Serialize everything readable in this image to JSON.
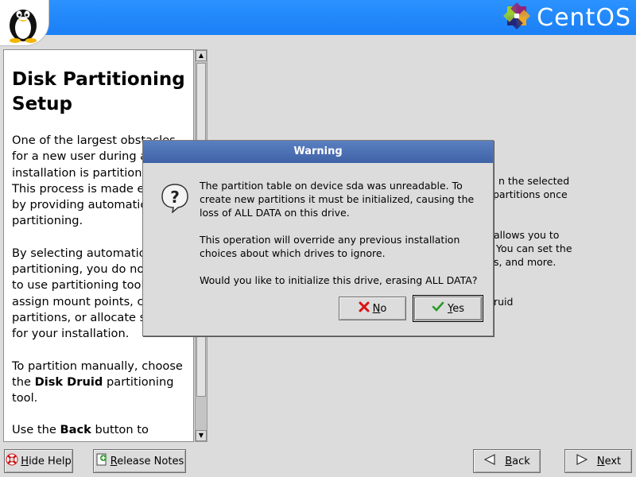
{
  "header": {
    "logo_text": "CentOS"
  },
  "help": {
    "title": "Disk Partitioning Setup",
    "p1": "One of the largest obstacles for a new user during a Linux installation is partitioning. This process is made easier by providing automatic partitioning.",
    "p2": "By selecting automatic partitioning, you do not have to use partitioning tools to assign mount points, create partitions, or allocate space for your installation.",
    "p3_pre": "To partition manually, choose the ",
    "p3_bold": "Disk Druid",
    "p3_post": " partitioning tool.",
    "p4_pre": "Use the ",
    "p4_bold": "Back",
    "p4_post": " button to choose a different installation"
  },
  "background": {
    "line1": "n the selected",
    "line2": "partitions once",
    "line3": "allows you to",
    "line4": "You can set the",
    "line5": "s, and more.",
    "line6": "ruid"
  },
  "dialog": {
    "title": "Warning",
    "msg1": "The partition table on device sda was unreadable. To create new partitions it must be initialized, causing the loss of ALL DATA on this drive.",
    "msg2": "This operation will override any previous installation choices about which drives to ignore.",
    "msg3": "Would you like to initialize this drive, erasing ALL DATA?",
    "no_mnemonic": "N",
    "no_rest": "o",
    "yes_mnemonic": "Y",
    "yes_rest": "es"
  },
  "buttons": {
    "hide_help_mnemonic": "H",
    "hide_help_rest": "ide Help",
    "release_notes_mnemonic": "R",
    "release_notes_rest": "elease Notes",
    "back_mnemonic": "B",
    "back_rest": "ack",
    "next_mnemonic": "N",
    "next_rest": "ext"
  },
  "colors": {
    "header_blue": "#1c87ff",
    "dialog_title": "#4c71b3"
  },
  "icons": {
    "tux": "tux-penguin-icon",
    "logo": "centos-logo-icon",
    "question": "question-icon",
    "no": "red-x-icon",
    "yes": "green-check-icon",
    "hide_help": "lifebuoy-icon",
    "release_notes": "notes-icon",
    "back": "arrow-left-icon",
    "next": "arrow-right-icon"
  }
}
